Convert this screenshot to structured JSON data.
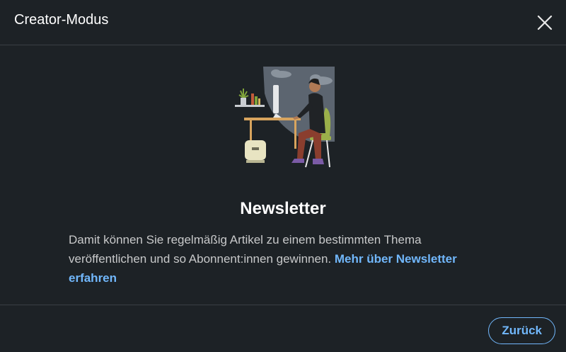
{
  "dialog": {
    "title": "Creator-Modus",
    "close_icon": "close-icon"
  },
  "content": {
    "heading": "Newsletter",
    "description": "Damit können Sie regelmäßig Artikel zu einem bestimmten Thema veröffentlichen und so Abonnent:innen gewinnen. ",
    "link_label": "Mehr über Newsletter erfahren"
  },
  "footer": {
    "back_label": "Zurück"
  },
  "colors": {
    "background": "#1d2226",
    "accent": "#71b7fb",
    "text": "#c8c9ca",
    "divider": "#3a3f44"
  }
}
